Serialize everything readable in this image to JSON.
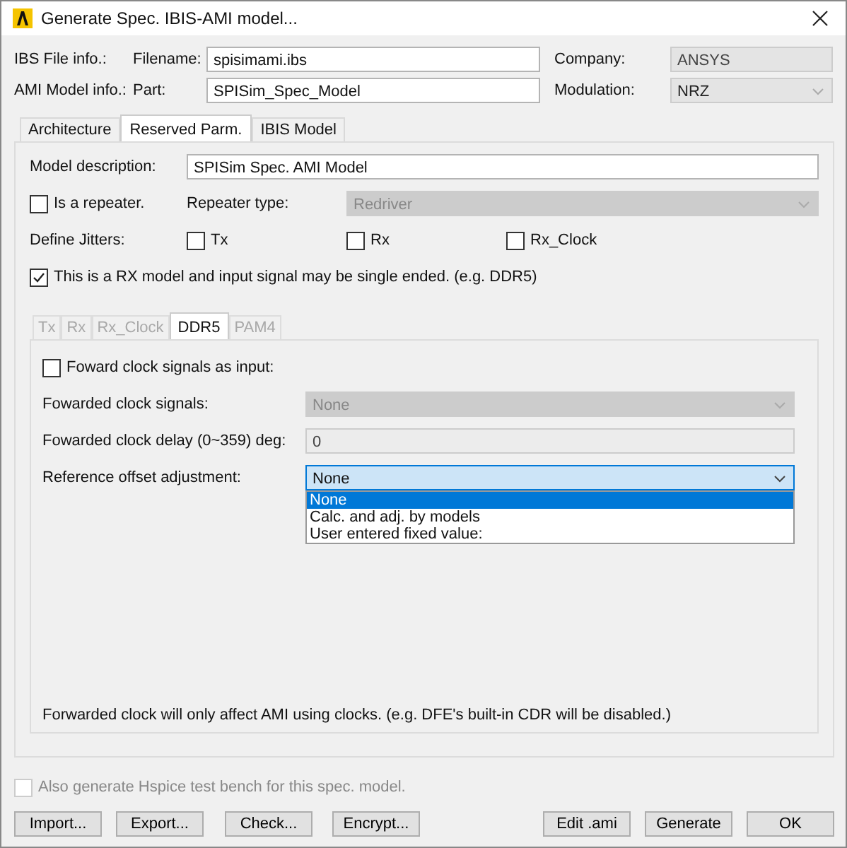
{
  "window": {
    "title": "Generate Spec. IBIS-AMI model..."
  },
  "header": {
    "ibs_label": "IBS File info.:",
    "filename_label": "Filename:",
    "filename": {
      "value": "spisimami.ibs",
      "disabled": false
    },
    "company_label": "Company:",
    "company": {
      "value": "ANSYS",
      "disabled": true
    },
    "ami_label": "AMI Model info.:",
    "part_label": "Part:",
    "part": {
      "value": "SPISim_Spec_Model",
      "disabled": false
    },
    "modulation_label": "Modulation:",
    "modulation": {
      "value": "NRZ",
      "disabled": true
    }
  },
  "tabs": [
    {
      "label": "Architecture",
      "selected": false
    },
    {
      "label": "Reserved Parm.",
      "selected": true
    },
    {
      "label": "IBIS Model",
      "selected": false
    }
  ],
  "reserved": {
    "description_label": "Model description:",
    "description": "SPISim Spec. AMI Model",
    "repeater": {
      "label": "Is a repeater.",
      "checked": false
    },
    "repeater_type_label": "Repeater type:",
    "repeater_type": {
      "value": "Redriver",
      "disabled": true
    },
    "jitters_label": "Define Jitters:",
    "jitters": [
      {
        "label": "Tx",
        "checked": false
      },
      {
        "label": "Rx",
        "checked": false
      },
      {
        "label": "Rx_Clock",
        "checked": false
      }
    ],
    "rx_model": {
      "label": "This is a RX model and input signal may be single ended. (e.g. DDR5)",
      "checked": true
    },
    "subtabs": [
      {
        "label": "Tx",
        "selected": false,
        "disabled": true
      },
      {
        "label": "Rx",
        "selected": false,
        "disabled": true
      },
      {
        "label": "Rx_Clock",
        "selected": false,
        "disabled": true
      },
      {
        "label": "DDR5",
        "selected": true,
        "disabled": false
      },
      {
        "label": "PAM4",
        "selected": false,
        "disabled": true
      }
    ],
    "ddr5": {
      "forward": {
        "label": "Foward clock signals as input:",
        "checked": false
      },
      "clock_signals_label": "Fowarded clock signals:",
      "clock_signals": {
        "value": "None",
        "disabled": true
      },
      "delay_label": "Fowarded clock delay (0~359) deg:",
      "delay": {
        "value": "0",
        "disabled": true
      },
      "offset_label": "Reference offset adjustment:",
      "offset": {
        "value": "None",
        "expanded": true,
        "options": [
          {
            "label": "None",
            "selected": true
          },
          {
            "label": "Calc. and adj. by models",
            "selected": false
          },
          {
            "label": "User entered fixed value:",
            "selected": false
          }
        ]
      },
      "note": "Forwarded clock will only affect AMI using clocks. (e.g. DFE's built-in CDR will be disabled.)"
    }
  },
  "hspice": {
    "label": "Also generate Hspice test bench for this spec. model.",
    "checked": false,
    "disabled": true
  },
  "buttons_left": [
    "Import...",
    "Export...",
    "Check...",
    "Encrypt..."
  ],
  "buttons_right": [
    "Edit .ami",
    "Generate",
    "OK"
  ]
}
